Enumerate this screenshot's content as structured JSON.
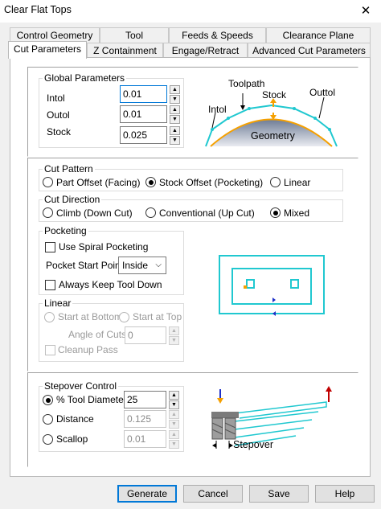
{
  "window": {
    "title": "Clear Flat Tops",
    "close_glyph": "✕"
  },
  "tabs_back": [
    {
      "name": "control-geometry",
      "label": "Control Geometry"
    },
    {
      "name": "tool",
      "label": "Tool"
    },
    {
      "name": "feeds-speeds",
      "label": "Feeds & Speeds"
    },
    {
      "name": "clearance-plane",
      "label": "Clearance Plane"
    }
  ],
  "tabs_front": [
    {
      "name": "cut-parameters",
      "label": "Cut Parameters",
      "active": true
    },
    {
      "name": "z-containment",
      "label": "Z Containment"
    },
    {
      "name": "engage-retract",
      "label": "Engage/Retract"
    },
    {
      "name": "advanced-cut-parameters",
      "label": "Advanced Cut Parameters"
    }
  ],
  "global": {
    "legend": "Global Parameters",
    "intol_label": "Intol",
    "intol_value": "0.01",
    "outol_label": "Outol",
    "outol_value": "0.01",
    "stock_label": "Stock",
    "stock_value": "0.025"
  },
  "diagram_tol": {
    "toolpath": "Toolpath",
    "stock": "Stock",
    "outtol": "Outtol",
    "intol": "Intol",
    "geometry": "Geometry"
  },
  "cut_pattern": {
    "legend": "Cut Pattern",
    "options": [
      "Part Offset (Facing)",
      "Stock Offset (Pocketing)",
      "Linear"
    ],
    "selected": "Stock Offset (Pocketing)"
  },
  "cut_direction": {
    "legend": "Cut Direction",
    "options": [
      "Climb (Down Cut)",
      "Conventional (Up Cut)",
      "Mixed"
    ],
    "selected": "Mixed"
  },
  "pocketing": {
    "legend": "Pocketing",
    "spiral_label": "Use Spiral Pocketing",
    "start_point_label": "Pocket Start Point",
    "start_point_value": "Inside",
    "keep_down_label": "Always Keep Tool Down"
  },
  "linear": {
    "legend": "Linear",
    "start_bottom": "Start at Bottom",
    "start_top": "Start at Top",
    "angle_label": "Angle of Cuts",
    "angle_value": "0",
    "cleanup_label": "Cleanup Pass"
  },
  "stepover": {
    "legend": "Stepover Control",
    "tool_diam_label": "% Tool Diameter",
    "tool_diam_value": "25",
    "distance_label": "Distance",
    "distance_value": "0.125",
    "scallop_label": "Scallop",
    "scallop_value": "0.01",
    "selected": "% Tool Diameter"
  },
  "diagram_stepover": {
    "label": "Stepover"
  },
  "buttons": {
    "generate": "Generate",
    "cancel": "Cancel",
    "save": "Save",
    "help": "Help"
  },
  "colors": {
    "cyan": "#20c8d0",
    "accent": "#0078d7",
    "orange": "#f5a000"
  },
  "icons": {
    "spin_up": "▲",
    "spin_down": "▼",
    "chevron": "⌵"
  }
}
